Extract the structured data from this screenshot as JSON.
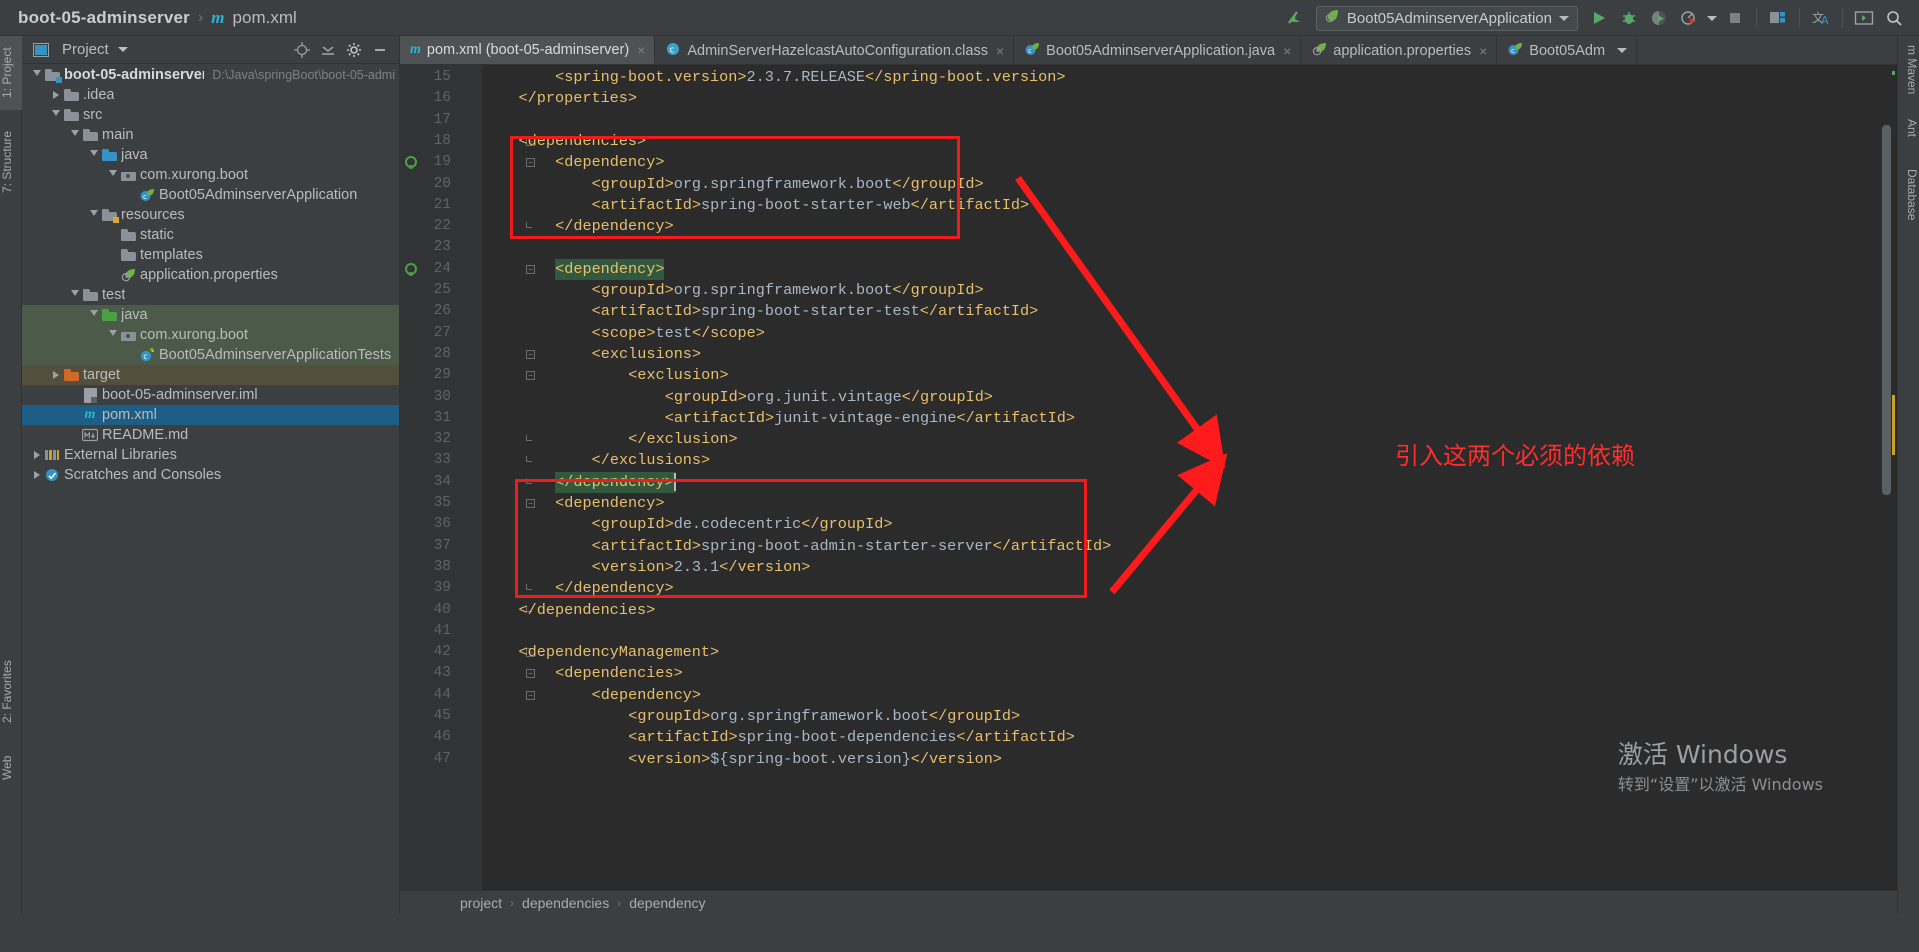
{
  "titlebar": {
    "project_name": "boot-05-adminserver",
    "separator": "›",
    "maven_glyph": "m",
    "file_name": "pom.xml",
    "run_config": "Boot05AdminserverApplication",
    "icons": {
      "back": "back-arrow-icon",
      "run": "run-icon",
      "debug": "debug-icon",
      "run_coverage": "run-with-coverage-icon",
      "profiler": "profiler-icon",
      "stop": "stop-icon",
      "project_structure": "project-structure-icon",
      "translate": "translate-icon",
      "terminal": "terminal-icon",
      "search": "search-everywhere-icon"
    }
  },
  "left_strip": {
    "tabs": [
      "1: Project",
      "7: Structure",
      "2: Favorites",
      "Web"
    ]
  },
  "right_strip": {
    "tabs": [
      "m Maven",
      "Ant",
      "Database"
    ]
  },
  "project_panel": {
    "title": "Project",
    "header_icons": [
      "locate-icon",
      "collapse-all-icon",
      "settings-gear-icon",
      "hide-icon"
    ],
    "tree": [
      {
        "indent": 0,
        "twisty": "open",
        "icon": "module-folder-icon",
        "label": "boot-05-adminserver",
        "sub": "D:\\Java\\springBoot\\boot-05-admi",
        "bold": true,
        "state": "normal"
      },
      {
        "indent": 1,
        "twisty": "closed",
        "icon": "folder-icon",
        "label": ".idea",
        "sub": "",
        "bold": false,
        "state": "normal"
      },
      {
        "indent": 1,
        "twisty": "open",
        "icon": "folder-icon",
        "label": "src",
        "sub": "",
        "bold": false,
        "state": "normal"
      },
      {
        "indent": 2,
        "twisty": "open",
        "icon": "folder-icon",
        "label": "main",
        "sub": "",
        "bold": false,
        "state": "normal"
      },
      {
        "indent": 3,
        "twisty": "open",
        "icon": "source-folder-icon",
        "label": "java",
        "sub": "",
        "bold": false,
        "state": "normal"
      },
      {
        "indent": 4,
        "twisty": "open",
        "icon": "package-icon",
        "label": "com.xurong.boot",
        "sub": "",
        "bold": false,
        "state": "normal"
      },
      {
        "indent": 5,
        "twisty": "none",
        "icon": "spring-class-icon",
        "label": "Boot05AdminserverApplication",
        "sub": "",
        "bold": false,
        "state": "normal"
      },
      {
        "indent": 3,
        "twisty": "open",
        "icon": "resource-folder-icon",
        "label": "resources",
        "sub": "",
        "bold": false,
        "state": "normal"
      },
      {
        "indent": 4,
        "twisty": "none",
        "icon": "folder-icon",
        "label": "static",
        "sub": "",
        "bold": false,
        "state": "normal"
      },
      {
        "indent": 4,
        "twisty": "none",
        "icon": "folder-icon",
        "label": "templates",
        "sub": "",
        "bold": false,
        "state": "normal"
      },
      {
        "indent": 4,
        "twisty": "none",
        "icon": "spring-properties-icon",
        "label": "application.properties",
        "sub": "",
        "bold": false,
        "state": "normal"
      },
      {
        "indent": 2,
        "twisty": "open",
        "icon": "folder-icon",
        "label": "test",
        "sub": "",
        "bold": false,
        "state": "normal"
      },
      {
        "indent": 3,
        "twisty": "open",
        "icon": "test-source-folder-icon",
        "label": "java",
        "sub": "",
        "bold": false,
        "state": "testroot"
      },
      {
        "indent": 4,
        "twisty": "open",
        "icon": "package-icon",
        "label": "com.xurong.boot",
        "sub": "",
        "bold": false,
        "state": "testroot"
      },
      {
        "indent": 5,
        "twisty": "none",
        "icon": "test-class-icon",
        "label": "Boot05AdminserverApplicationTests",
        "sub": "",
        "bold": false,
        "state": "testroot"
      },
      {
        "indent": 1,
        "twisty": "closed",
        "icon": "excluded-folder-icon",
        "label": "target",
        "sub": "",
        "bold": false,
        "state": "excluded"
      },
      {
        "indent": 2,
        "twisty": "none",
        "icon": "iml-file-icon",
        "label": "boot-05-adminserver.iml",
        "sub": "",
        "bold": false,
        "state": "normal"
      },
      {
        "indent": 2,
        "twisty": "none",
        "icon": "maven-file-icon",
        "label": "pom.xml",
        "sub": "",
        "bold": false,
        "state": "selected"
      },
      {
        "indent": 2,
        "twisty": "none",
        "icon": "markdown-file-icon",
        "label": "README.md",
        "sub": "",
        "bold": false,
        "state": "normal"
      },
      {
        "indent": 0,
        "twisty": "closed",
        "icon": "library-icon",
        "label": "External Libraries",
        "sub": "",
        "bold": false,
        "state": "normal"
      },
      {
        "indent": 0,
        "twisty": "closed",
        "icon": "scratches-icon",
        "label": "Scratches and Consoles",
        "sub": "",
        "bold": false,
        "state": "normal"
      }
    ]
  },
  "editor_tabs": [
    {
      "label": "pom.xml (boot-05-adminserver)",
      "icon": "maven-file-icon",
      "active": true,
      "closeable": true
    },
    {
      "label": "AdminServerHazelcastAutoConfiguration.class",
      "icon": "class-file-icon",
      "active": false,
      "closeable": true
    },
    {
      "label": "Boot05AdminserverApplication.java",
      "icon": "spring-class-icon",
      "active": false,
      "closeable": true
    },
    {
      "label": "application.properties",
      "icon": "spring-properties-icon",
      "active": false,
      "closeable": true
    },
    {
      "label": "Boot05Adm",
      "icon": "spring-class-icon",
      "active": false,
      "closeable": false
    }
  ],
  "editor": {
    "first_line_number": 15,
    "lines": [
      {
        "n": 15,
        "indent": 8,
        "text": "<spring-boot.version>2.3.7.RELEASE</spring-boot.version>",
        "kind": "tagline"
      },
      {
        "n": 16,
        "indent": 4,
        "text": "</properties>",
        "kind": "tag"
      },
      {
        "n": 17,
        "indent": 0,
        "text": "",
        "kind": "plain"
      },
      {
        "n": 18,
        "indent": 4,
        "text": "<dependencies>",
        "kind": "tag",
        "fold": true
      },
      {
        "n": 19,
        "indent": 8,
        "text": "<dependency>",
        "kind": "tag",
        "fold": true,
        "gutter_marker": true
      },
      {
        "n": 20,
        "indent": 12,
        "text": "<groupId>org.springframework.boot</groupId>",
        "kind": "tagline"
      },
      {
        "n": 21,
        "indent": 12,
        "text": "<artifactId>spring-boot-starter-web</artifactId>",
        "kind": "tagline"
      },
      {
        "n": 22,
        "indent": 8,
        "text": "</dependency>",
        "kind": "tag",
        "foldend": true
      },
      {
        "n": 23,
        "indent": 0,
        "text": "",
        "kind": "plain"
      },
      {
        "n": 24,
        "indent": 8,
        "text": "<dependency>",
        "kind": "tag",
        "fold": true,
        "gutter_marker": true,
        "highlight": true
      },
      {
        "n": 25,
        "indent": 12,
        "text": "<groupId>org.springframework.boot</groupId>",
        "kind": "tagline"
      },
      {
        "n": 26,
        "indent": 12,
        "text": "<artifactId>spring-boot-starter-test</artifactId>",
        "kind": "tagline"
      },
      {
        "n": 27,
        "indent": 12,
        "text": "<scope>test</scope>",
        "kind": "tagline"
      },
      {
        "n": 28,
        "indent": 12,
        "text": "<exclusions>",
        "kind": "tag",
        "fold": true
      },
      {
        "n": 29,
        "indent": 16,
        "text": "<exclusion>",
        "kind": "tag",
        "fold": true
      },
      {
        "n": 30,
        "indent": 20,
        "text": "<groupId>org.junit.vintage</groupId>",
        "kind": "tagline"
      },
      {
        "n": 31,
        "indent": 20,
        "text": "<artifactId>junit-vintage-engine</artifactId>",
        "kind": "tagline"
      },
      {
        "n": 32,
        "indent": 16,
        "text": "</exclusion>",
        "kind": "tag",
        "foldend": true
      },
      {
        "n": 33,
        "indent": 12,
        "text": "</exclusions>",
        "kind": "tag",
        "foldend": true
      },
      {
        "n": 34,
        "indent": 8,
        "text": "</dependency>",
        "kind": "tag",
        "foldend": true,
        "highlight": true,
        "caret": true
      },
      {
        "n": 35,
        "indent": 8,
        "text": "<dependency>",
        "kind": "tag",
        "fold": true
      },
      {
        "n": 36,
        "indent": 12,
        "text": "<groupId>de.codecentric</groupId>",
        "kind": "tagline"
      },
      {
        "n": 37,
        "indent": 12,
        "text": "<artifactId>spring-boot-admin-starter-server</artifactId>",
        "kind": "tagline"
      },
      {
        "n": 38,
        "indent": 12,
        "text": "<version>2.3.1</version>",
        "kind": "tagline"
      },
      {
        "n": 39,
        "indent": 8,
        "text": "</dependency>",
        "kind": "tag",
        "foldend": true
      },
      {
        "n": 40,
        "indent": 4,
        "text": "</dependencies>",
        "kind": "tag",
        "foldend": true
      },
      {
        "n": 41,
        "indent": 0,
        "text": "",
        "kind": "plain"
      },
      {
        "n": 42,
        "indent": 4,
        "text": "<dependencyManagement>",
        "kind": "tag",
        "fold": true
      },
      {
        "n": 43,
        "indent": 8,
        "text": "<dependencies>",
        "kind": "tag",
        "fold": true
      },
      {
        "n": 44,
        "indent": 12,
        "text": "<dependency>",
        "kind": "tag",
        "fold": true
      },
      {
        "n": 45,
        "indent": 16,
        "text": "<groupId>org.springframework.boot</groupId>",
        "kind": "tagline"
      },
      {
        "n": 46,
        "indent": 16,
        "text": "<artifactId>spring-boot-dependencies</artifactId>",
        "kind": "tagline"
      },
      {
        "n": 47,
        "indent": 16,
        "text": "<version>${spring-boot.version}</version>",
        "kind": "tagline"
      }
    ]
  },
  "annotations": {
    "note_cn": "引入这两个必须的依赖",
    "box_color": "#f01c1c",
    "arrow_color": "#ff1b1b"
  },
  "breadcrumb": {
    "items": [
      "project",
      "dependencies",
      "dependency"
    ],
    "separator": "›"
  },
  "watermark": {
    "line1": "激活 Windows",
    "line2": "转到“设置”以激活 Windows"
  }
}
